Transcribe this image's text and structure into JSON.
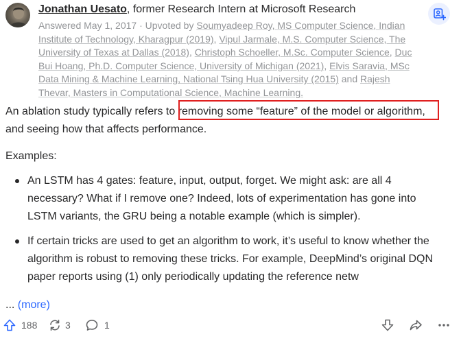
{
  "author": {
    "name": "Jonathan Uesato",
    "credential": ", former Research Intern at Microsoft Research"
  },
  "meta": {
    "answered": "Answered May 1, 2017 · Upvoted by ",
    "upvoters": [
      {
        "name": "Soumyadeep Roy",
        "credential": "MS Computer Science, Indian Institute of Technology, Kharagpur (2019)"
      },
      {
        "name": "Vipul Jarmale",
        "credential": "M.S. Computer Science, The University of Texas at Dallas (2018)"
      },
      {
        "name": "Christoph Schoeller",
        "credential": "M.Sc. Computer Science"
      },
      {
        "name": "Duc Bui Hoang",
        "credential": "Ph.D. Computer Science, University of Michigan (2021)"
      },
      {
        "name": "Elvis Saravia",
        "credential": "MSc Data Mining & Machine Learning, National Tsing Hua University (2015)"
      },
      {
        "name": "Rajesh Thevar",
        "credential": "Masters in Computational Science, Machine Learning."
      }
    ],
    "sep": ", ",
    "and_text": " and "
  },
  "answer": {
    "para1_before": "An ablation study typically refers to ",
    "para1_highlight": "removing some “feature” of the model or algorithm,",
    "para1_after": " and seeing how that affects performance.",
    "examples_label": "Examples:",
    "bullets": [
      "An LSTM has 4 gates: feature, input, output, forget. We might ask: are all 4 necessary? What if I remove one? Indeed, lots of experimentation has gone into LSTM variants, the GRU being a notable example (which is simpler).",
      "If certain tricks are used to get an algorithm to work, it’s useful to know whether the algorithm is robust to removing these tricks. For example, DeepMind’s original DQN paper reports using (1) only periodically updating the reference netw"
    ],
    "ellipsis": "... ",
    "more_label": "(more)"
  },
  "actions": {
    "upvote_count": "188",
    "share_count": "3",
    "comment_count": "1",
    "icons": [
      "upvote-icon",
      "reshare-icon",
      "comment-icon",
      "downvote-icon",
      "share-icon",
      "more-icon",
      "follow-user-icon"
    ]
  },
  "colors": {
    "text": "#282829",
    "meta": "#939598",
    "link": "#2e69ff",
    "upvote": "#2e69ff",
    "highlight_box": "#e02020",
    "follow_bg": "#ebf0ff"
  }
}
